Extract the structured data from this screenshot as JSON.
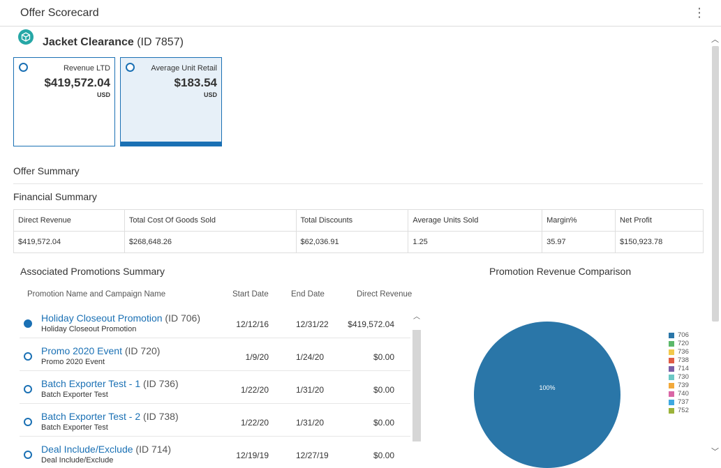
{
  "header": {
    "title": "Offer Scorecard"
  },
  "offer": {
    "name": "Jacket Clearance",
    "id_text": "(ID 7857)"
  },
  "tiles": [
    {
      "label": "Revenue LTD",
      "value": "$419,572.04",
      "unit": "USD",
      "selected": false
    },
    {
      "label": "Average Unit Retail",
      "value": "$183.54",
      "unit": "USD",
      "selected": true
    }
  ],
  "offer_summary_title": "Offer Summary",
  "financial": {
    "title": "Financial Summary",
    "headers": [
      "Direct Revenue",
      "Total Cost Of Goods Sold",
      "Total Discounts",
      "Average Units Sold",
      "Margin%",
      "Net Profit"
    ],
    "values": [
      "$419,572.04",
      "$268,648.26",
      "$62,036.91",
      "1.25",
      "35.97",
      "$150,923.78"
    ]
  },
  "promotions": {
    "title": "Associated Promotions Summary",
    "headers": [
      "Promotion Name and Campaign Name",
      "Start Date",
      "End Date",
      "Direct Revenue"
    ],
    "rows": [
      {
        "name": "Holiday Closeout Promotion",
        "id": "(ID 706)",
        "campaign": "Holiday Closeout Promotion",
        "start": "12/12/16",
        "end": "12/31/22",
        "revenue": "$419,572.04",
        "selected": true
      },
      {
        "name": "Promo 2020 Event",
        "id": "(ID 720)",
        "campaign": "Promo 2020 Event",
        "start": "1/9/20",
        "end": "1/24/20",
        "revenue": "$0.00",
        "selected": false
      },
      {
        "name": "Batch Exporter Test - 1",
        "id": "(ID 736)",
        "campaign": "Batch Exporter Test",
        "start": "1/22/20",
        "end": "1/31/20",
        "revenue": "$0.00",
        "selected": false
      },
      {
        "name": "Batch Exporter Test - 2",
        "id": "(ID 738)",
        "campaign": "Batch Exporter Test",
        "start": "1/22/20",
        "end": "1/31/20",
        "revenue": "$0.00",
        "selected": false
      },
      {
        "name": "Deal Include/Exclude",
        "id": "(ID 714)",
        "campaign": "Deal Include/Exclude",
        "start": "12/19/19",
        "end": "12/27/19",
        "revenue": "$0.00",
        "selected": false
      }
    ]
  },
  "chart_data": {
    "type": "pie",
    "title": "Promotion Revenue Comparison",
    "slices": [
      {
        "label": "706",
        "value": 100,
        "color": "#2a76a8"
      },
      {
        "label": "720",
        "value": 0,
        "color": "#5cb86a"
      },
      {
        "label": "736",
        "value": 0,
        "color": "#f2c94c"
      },
      {
        "label": "738",
        "value": 0,
        "color": "#e05c45"
      },
      {
        "label": "714",
        "value": 0,
        "color": "#7b5ea7"
      },
      {
        "label": "730",
        "value": 0,
        "color": "#6cc8c5"
      },
      {
        "label": "739",
        "value": 0,
        "color": "#f2a93b"
      },
      {
        "label": "740",
        "value": 0,
        "color": "#d966a5"
      },
      {
        "label": "737",
        "value": 0,
        "color": "#3ea8e0"
      },
      {
        "label": "752",
        "value": 0,
        "color": "#9cb33a"
      }
    ],
    "slice_label": "100%"
  },
  "colors": {
    "accent": "#1a70b4",
    "offer_icon": "#26a7a6"
  },
  "icons": {
    "offer": "cube-icon",
    "menu": "kebab-menu-icon"
  }
}
